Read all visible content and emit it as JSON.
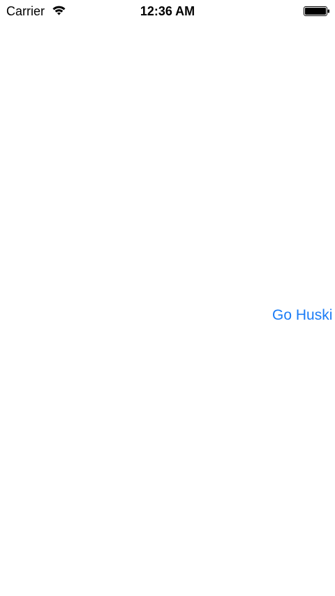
{
  "status_bar": {
    "carrier": "Carrier",
    "time": "12:36 AM",
    "wifi_icon": "wifi-icon",
    "battery_icon": "battery-icon"
  },
  "main": {
    "button_label": "Go Huski"
  },
  "colors": {
    "accent": "#1a7cf6",
    "background": "#ffffff",
    "status_text": "#000000"
  }
}
